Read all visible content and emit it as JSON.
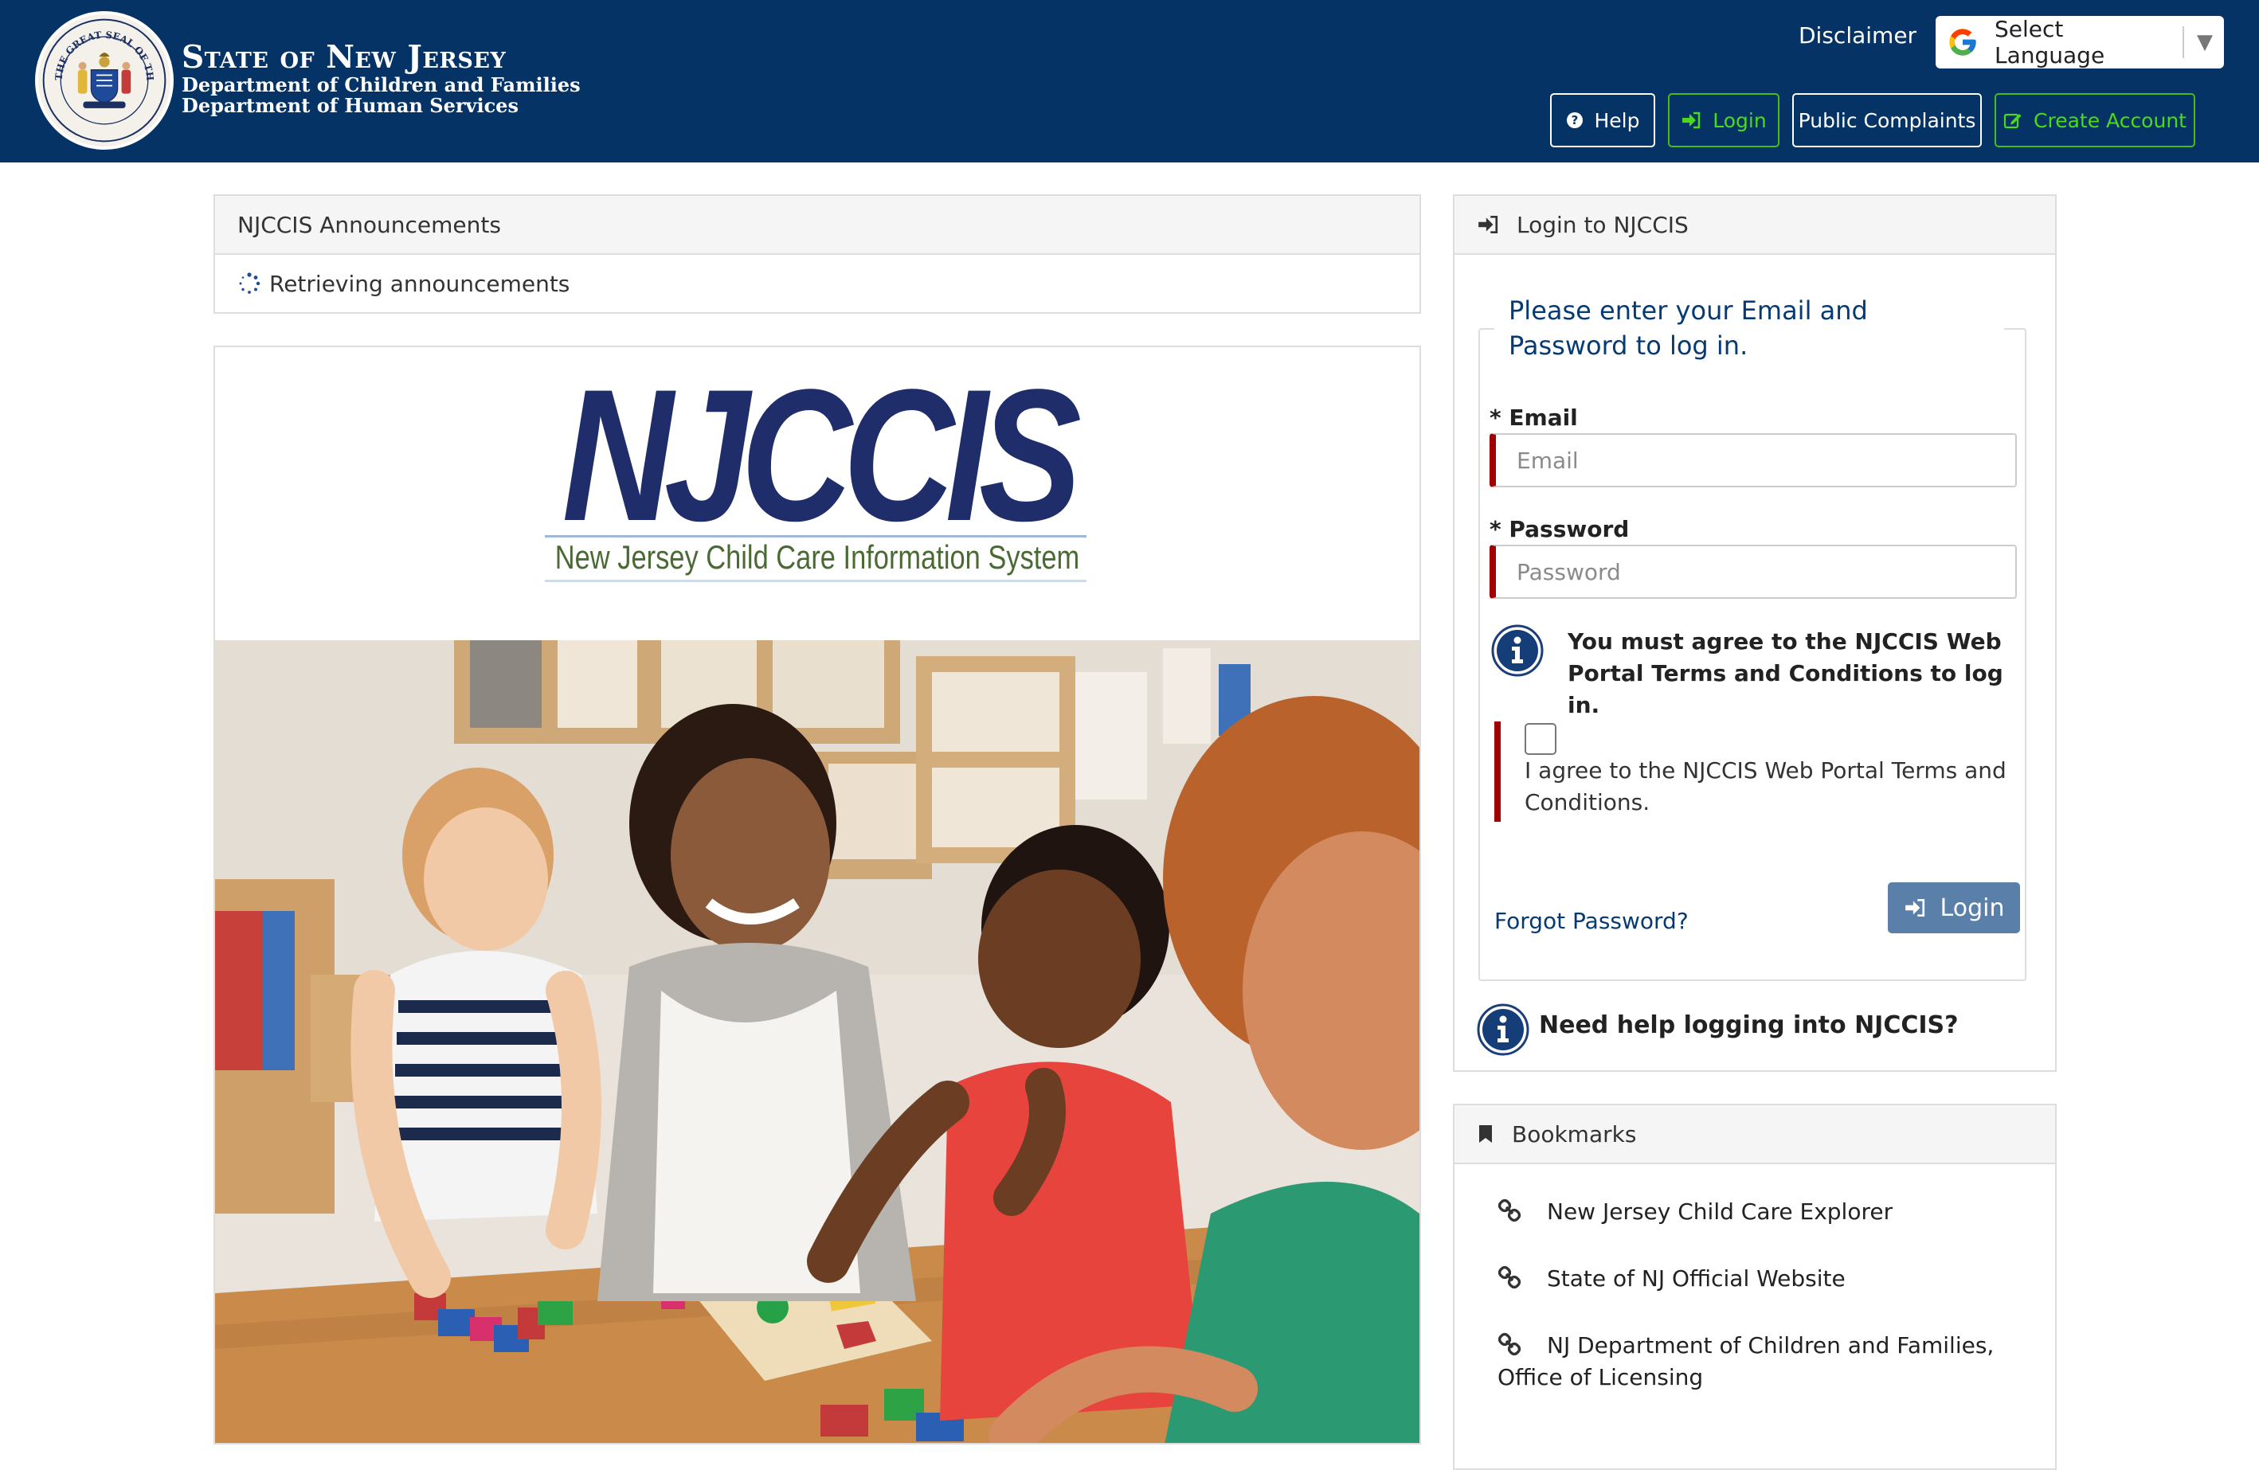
{
  "header": {
    "seal_text": "THE GREAT SEAL OF THE STATE OF NEW JERSEY",
    "title_line1": "State of New Jersey",
    "title_line2": "Department of Children and Families",
    "title_line3": "Department of Human Services",
    "disclaimer": "Disclaimer",
    "language_select": "Select Language",
    "buttons": {
      "help": "Help",
      "login": "Login",
      "public_complaints": "Public Complaints",
      "create_account": "Create Account"
    }
  },
  "announcements": {
    "title": "NJCCIS Announcements",
    "status": "Retrieving announcements"
  },
  "hero": {
    "logo_main": "NJCCIS",
    "logo_subtitle": "New Jersey Child Care Information System"
  },
  "login_panel": {
    "title": "Login to NJCCIS",
    "legend": "Please enter your Email and Password to log in.",
    "email_label": "* Email",
    "email_placeholder": "Email",
    "password_label": "* Password",
    "password_placeholder": "Password",
    "terms_notice": "You must agree to the NJCCIS Web Portal Terms and Conditions to log in.",
    "agree_label": "I agree to the NJCCIS Web Portal Terms and Conditions.",
    "forgot_password": "Forgot Password?",
    "login_button": "Login",
    "need_help": "Need help logging into NJCCIS?"
  },
  "bookmarks": {
    "title": "Bookmarks",
    "items": [
      "New Jersey Child Care Explorer",
      "State of NJ Official Website",
      "NJ Department of Children and Families, Office of Licensing"
    ]
  },
  "colors": {
    "header_bg": "#053366",
    "accent_green": "#4cbb17",
    "link_blue": "#063a74",
    "required_red": "#a00000",
    "login_button": "#5a7fa8"
  },
  "icons": {
    "help": "question-circle-icon",
    "login": "sign-in-icon",
    "create_account": "edit-icon",
    "bookmark": "bookmark-icon",
    "link": "link-icon",
    "info": "info-circle-icon",
    "spinner": "spinner-icon",
    "google": "google-logo-icon"
  }
}
